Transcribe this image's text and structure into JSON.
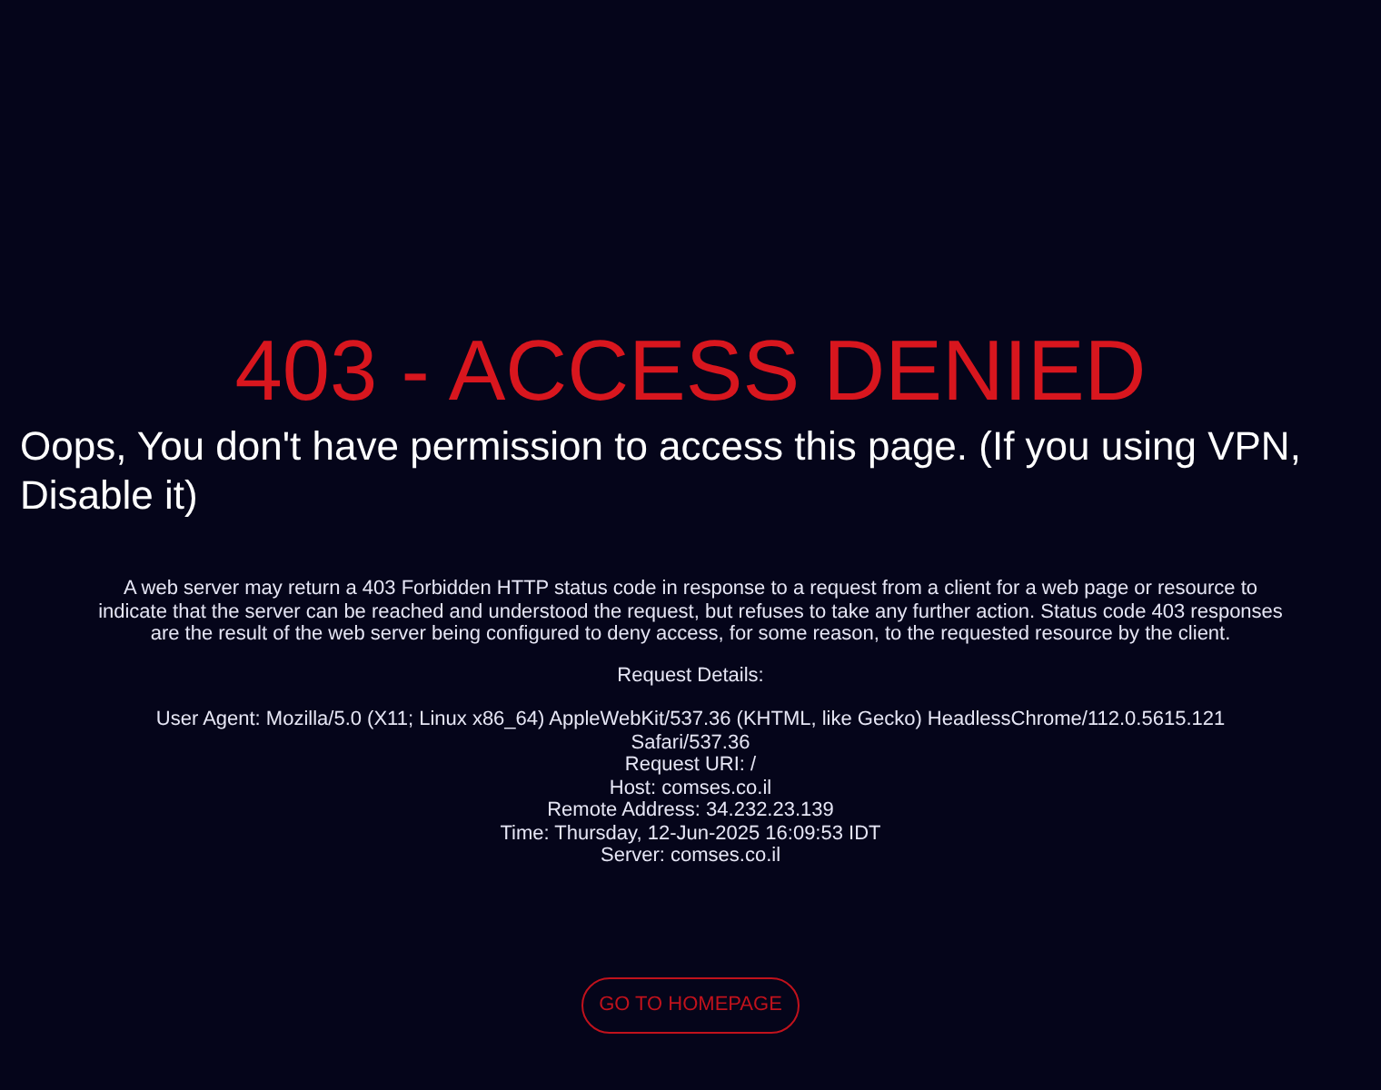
{
  "heading": "403 - ACCESS DENIED",
  "subheading": "Oops, You don't have permission to access this page. (If you using VPN, Disable it)",
  "description": "A web server may return a 403 Forbidden HTTP status code in response to a request from a client for a web page or resource to indicate that the server can be reached and understood the request, but refuses to take any further action. Status code 403 responses are the result of the web server being configured to deny access, for some reason, to the requested resource by the client.",
  "details_title": "Request Details:",
  "details": [
    "User Agent: Mozilla/5.0 (X11; Linux x86_64) AppleWebKit/537.36 (KHTML, like Gecko) HeadlessChrome/112.0.5615.121 Safari/537.36",
    "Request URI: /",
    "Host: comses.co.il",
    "Remote Address: 34.232.23.139",
    "Time: Thursday, 12-Jun-2025 16:09:53 IDT",
    "Server: comses.co.il"
  ],
  "button": "GO TO HOMEPAGE"
}
